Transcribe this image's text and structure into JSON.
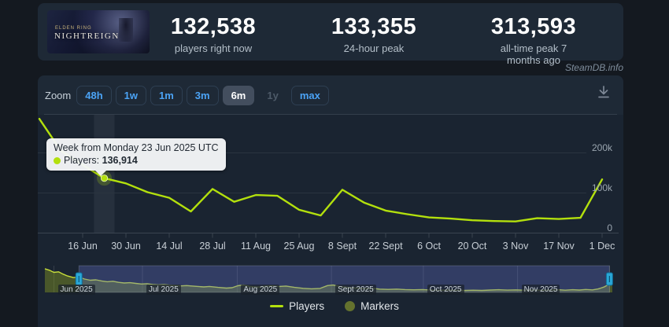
{
  "site": {
    "watermark": "SteamDB.info"
  },
  "game": {
    "name_line1": "ELDEN RING",
    "name_line2": "NIGHTREIGN"
  },
  "stats": [
    {
      "value": "132,538",
      "label": "players right now"
    },
    {
      "value": "133,355",
      "label": "24-hour peak"
    },
    {
      "value": "313,593",
      "label": "all-time peak 7 months ago"
    }
  ],
  "toolbar": {
    "zoom_label": "Zoom",
    "buttons": [
      {
        "label": "48h",
        "state": "normal"
      },
      {
        "label": "1w",
        "state": "normal"
      },
      {
        "label": "1m",
        "state": "normal"
      },
      {
        "label": "3m",
        "state": "normal"
      },
      {
        "label": "6m",
        "state": "selected"
      },
      {
        "label": "1y",
        "state": "disabled"
      },
      {
        "label": "max",
        "state": "normal"
      }
    ]
  },
  "tooltip": {
    "title": "Week from Monday 23 Jun 2025 UTC",
    "series_label": "Players:",
    "value": "136,914"
  },
  "legend": [
    {
      "label": "Players",
      "swatch": "line"
    },
    {
      "label": "Markers",
      "swatch": "circle"
    }
  ],
  "colors": {
    "line": "#b3e00d",
    "marker_halo": "rgba(179,224,13,0.22)",
    "markers_legend": "#64722e",
    "accent_blue": "#4ba3f5",
    "nav_mask": "rgba(96,112,200,0.34)",
    "nav_area": "rgba(130,150,35,0.45)",
    "nav_line": "#c6dd3a",
    "nav_handle": "#2aa7d6"
  },
  "chart_data": {
    "type": "line",
    "title": "",
    "xlabel": "",
    "ylabel": "",
    "ylim": [
      0,
      250000
    ],
    "grid": "horizontal",
    "legend_position": "bottom",
    "y_ticks": [
      {
        "value": 0,
        "label": "0"
      },
      {
        "value": 100000,
        "label": "100k"
      },
      {
        "value": 200000,
        "label": "200k"
      }
    ],
    "x_ticks": [
      "16 Jun",
      "30 Jun",
      "14 Jul",
      "28 Jul",
      "11 Aug",
      "25 Aug",
      "8 Sept",
      "22 Sept",
      "6 Oct",
      "20 Oct",
      "3 Nov",
      "17 Nov",
      "1 Dec"
    ],
    "series": [
      {
        "name": "Players",
        "interval": "weekly",
        "dates": [
          "2025-06-02",
          "2025-06-09",
          "2025-06-16",
          "2025-06-23",
          "2025-06-30",
          "2025-07-07",
          "2025-07-14",
          "2025-07-21",
          "2025-07-28",
          "2025-08-04",
          "2025-08-11",
          "2025-08-18",
          "2025-08-25",
          "2025-09-01",
          "2025-09-08",
          "2025-09-15",
          "2025-09-22",
          "2025-09-29",
          "2025-10-06",
          "2025-10-13",
          "2025-10-20",
          "2025-10-27",
          "2025-11-03",
          "2025-11-10",
          "2025-11-17",
          "2025-11-24",
          "2025-12-01"
        ],
        "values": [
          285000,
          205000,
          170000,
          136914,
          124000,
          102000,
          88000,
          54000,
          110000,
          78000,
          95000,
          93000,
          58000,
          44000,
          108000,
          76000,
          56000,
          47000,
          39000,
          36000,
          32000,
          30000,
          29000,
          37000,
          35000,
          38000,
          134000
        ]
      }
    ],
    "hover_point": {
      "index": 3,
      "date": "2025-06-23",
      "value": 136914
    },
    "navigator": {
      "range_label_months": [
        "Jun 2025",
        "Jul 2025",
        "Aug 2025",
        "Sept 2025",
        "Oct 2025",
        "Nov 2025"
      ],
      "month_fractions": [
        0.016,
        0.172,
        0.339,
        0.505,
        0.667,
        0.833,
        0.995
      ],
      "selected_range_fraction": [
        0.06,
        0.995
      ],
      "max_players_k": 350,
      "points_players_k": [
        [
          0,
          310
        ],
        [
          0.008,
          290
        ],
        [
          0.016,
          262
        ],
        [
          0.024,
          270
        ],
        [
          0.032,
          240
        ],
        [
          0.04,
          215
        ],
        [
          0.05,
          195
        ],
        [
          0.06,
          200
        ],
        [
          0.07,
          175
        ],
        [
          0.08,
          160
        ],
        [
          0.09,
          165
        ],
        [
          0.1,
          150
        ],
        [
          0.11,
          140
        ],
        [
          0.12,
          146
        ],
        [
          0.13,
          132
        ],
        [
          0.14,
          124
        ],
        [
          0.15,
          128
        ],
        [
          0.16,
          118
        ],
        [
          0.17,
          110
        ],
        [
          0.18,
          114
        ],
        [
          0.19,
          104
        ],
        [
          0.2,
          98
        ],
        [
          0.21,
          102
        ],
        [
          0.225,
          92
        ],
        [
          0.24,
          85
        ],
        [
          0.25,
          90
        ],
        [
          0.265,
          80
        ],
        [
          0.28,
          72
        ],
        [
          0.29,
          78
        ],
        [
          0.305,
          66
        ],
        [
          0.32,
          57
        ],
        [
          0.33,
          62
        ],
        [
          0.34,
          88
        ],
        [
          0.35,
          97
        ],
        [
          0.362,
          78
        ],
        [
          0.375,
          70
        ],
        [
          0.388,
          80
        ],
        [
          0.4,
          86
        ],
        [
          0.413,
          78
        ],
        [
          0.425,
          83
        ],
        [
          0.44,
          66
        ],
        [
          0.455,
          54
        ],
        [
          0.47,
          47
        ],
        [
          0.485,
          53
        ],
        [
          0.498,
          90
        ],
        [
          0.508,
          97
        ],
        [
          0.52,
          78
        ],
        [
          0.535,
          65
        ],
        [
          0.55,
          57
        ],
        [
          0.565,
          50
        ],
        [
          0.578,
          54
        ],
        [
          0.59,
          43
        ],
        [
          0.605,
          39
        ],
        [
          0.62,
          43
        ],
        [
          0.635,
          37
        ],
        [
          0.65,
          34
        ],
        [
          0.665,
          37
        ],
        [
          0.68,
          32
        ],
        [
          0.695,
          29
        ],
        [
          0.71,
          32
        ],
        [
          0.725,
          28
        ],
        [
          0.74,
          26
        ],
        [
          0.755,
          29
        ],
        [
          0.77,
          26
        ],
        [
          0.785,
          31
        ],
        [
          0.8,
          35
        ],
        [
          0.815,
          30
        ],
        [
          0.83,
          33
        ],
        [
          0.845,
          29
        ],
        [
          0.86,
          33
        ],
        [
          0.875,
          29
        ],
        [
          0.89,
          32
        ],
        [
          0.905,
          35
        ],
        [
          0.917,
          29
        ],
        [
          0.93,
          35
        ],
        [
          0.942,
          31
        ],
        [
          0.953,
          38
        ],
        [
          0.965,
          33
        ],
        [
          0.975,
          45
        ],
        [
          0.985,
          70
        ],
        [
          1.0,
          130
        ]
      ]
    }
  }
}
